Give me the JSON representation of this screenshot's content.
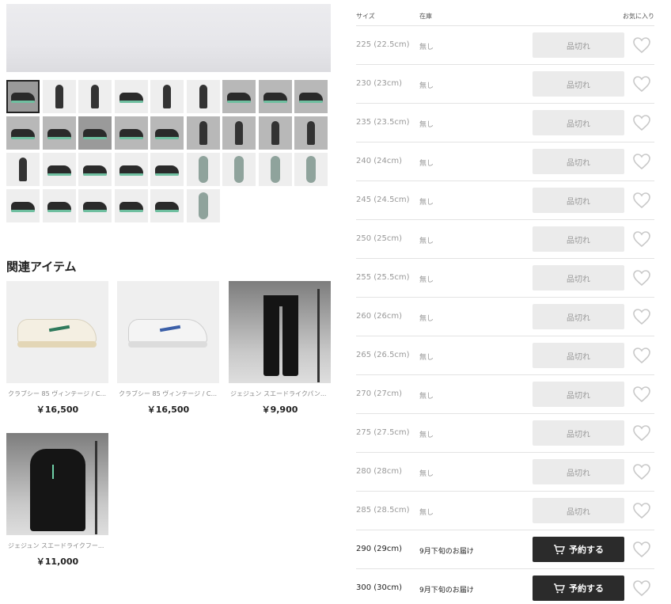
{
  "related": {
    "title": "関連アイテム",
    "items": [
      {
        "name": "クラブシー 85 ヴィンテージ / C...",
        "price": "￥16,500"
      },
      {
        "name": "クラブシー 85 ヴィンテージ / C...",
        "price": "￥16,500"
      },
      {
        "name": "ジェジュン スエードライクパン...",
        "price": "￥9,900"
      },
      {
        "name": "ジェジュン スエードライクフー...",
        "price": "￥11,000"
      }
    ]
  },
  "size_table": {
    "headers": {
      "size": "サイズ",
      "stock": "在庫",
      "favorite": "お気に入り"
    },
    "rows": [
      {
        "size": "225 (22.5cm)",
        "stock": "無し",
        "button": "品切れ",
        "available": false
      },
      {
        "size": "230 (23cm)",
        "stock": "無し",
        "button": "品切れ",
        "available": false
      },
      {
        "size": "235 (23.5cm)",
        "stock": "無し",
        "button": "品切れ",
        "available": false
      },
      {
        "size": "240 (24cm)",
        "stock": "無し",
        "button": "品切れ",
        "available": false
      },
      {
        "size": "245 (24.5cm)",
        "stock": "無し",
        "button": "品切れ",
        "available": false
      },
      {
        "size": "250 (25cm)",
        "stock": "無し",
        "button": "品切れ",
        "available": false
      },
      {
        "size": "255 (25.5cm)",
        "stock": "無し",
        "button": "品切れ",
        "available": false
      },
      {
        "size": "260 (26cm)",
        "stock": "無し",
        "button": "品切れ",
        "available": false
      },
      {
        "size": "265 (26.5cm)",
        "stock": "無し",
        "button": "品切れ",
        "available": false
      },
      {
        "size": "270 (27cm)",
        "stock": "無し",
        "button": "品切れ",
        "available": false
      },
      {
        "size": "275 (27.5cm)",
        "stock": "無し",
        "button": "品切れ",
        "available": false
      },
      {
        "size": "280 (28cm)",
        "stock": "無し",
        "button": "品切れ",
        "available": false
      },
      {
        "size": "285 (28.5cm)",
        "stock": "無し",
        "button": "品切れ",
        "available": false
      },
      {
        "size": "290 (29cm)",
        "stock": "9月下旬のお届け",
        "button": "予約する",
        "available": true
      },
      {
        "size": "300 (30cm)",
        "stock": "9月下旬のお届け",
        "button": "予約する",
        "available": true
      }
    ]
  },
  "icons": {
    "heart": "heart-outline-icon",
    "cart": "cart-icon"
  },
  "colors": {
    "reserve_button": "#2b2b2b",
    "soldout_button": "#ebebeb",
    "heart_stroke": "#c8c8c8"
  }
}
